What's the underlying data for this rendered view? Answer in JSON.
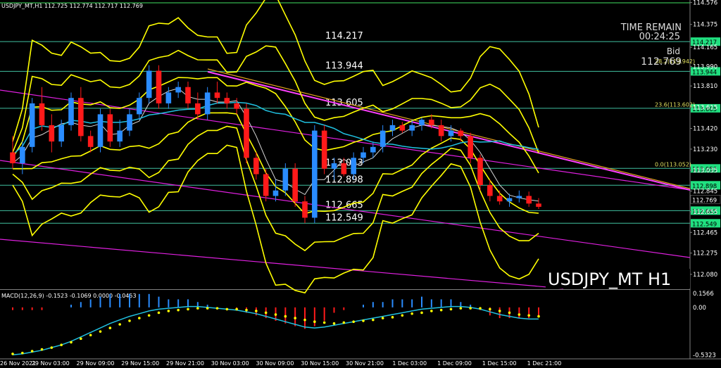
{
  "window": {
    "header": "USDJPY_MT,H1  112.725 112.774 112.717 112.769",
    "time_remain_label": "TIME REMAIN",
    "time_remain": "00:24:25",
    "bid_label": "Bid",
    "bid_value": "112.769",
    "chart_label": "USDJPY_MT H1",
    "macd_label": "MACD(12,26,9) -0.1523 -0.1069 0.0000 -0.0453"
  },
  "colors": {
    "background": "#000000",
    "bull": "#2a8cff",
    "bear": "#ff1a1a",
    "bollinger": "#ffff00",
    "level": "#40c0a0",
    "channel": "#e020e0",
    "trend": "#e0a020",
    "ma_cyan": "#20c0e0",
    "ma_white": "#d8d8d8",
    "macd_hist": "#2a8cff",
    "macd_hist_neg": "#ff1a1a",
    "macd_line": "#20c0e0",
    "macd_signal": "#ffff00",
    "axis_text": "#ffffff",
    "price_tag": "#20e080"
  },
  "chart_data": {
    "type": "candlestick",
    "symbol": "USDJPY_MT",
    "timeframe": "H1",
    "ylim": [
      111.95,
      114.58
    ],
    "y_ticks": [
      "114.576",
      "114.375",
      "114.165",
      "113.990",
      "113.810",
      "113.615",
      "113.420",
      "113.230",
      "113.035",
      "112.845",
      "112.655",
      "112.465",
      "112.275",
      "112.080"
    ],
    "x_ticks": [
      "26 Nov 2021",
      "29 Nov 03:00",
      "29 Nov 09:00",
      "29 Nov 15:00",
      "29 Nov 21:00",
      "30 Nov 03:00",
      "30 Nov 09:00",
      "30 Nov 15:00",
      "30 Nov 21:00",
      "1 Dec 03:00",
      "1 Dec 09:00",
      "1 Dec 15:00",
      "1 Dec 21:00"
    ],
    "levels": [
      {
        "value": 114.217,
        "label": "114.217",
        "tag": "114.217"
      },
      {
        "value": 113.944,
        "label": "113.944",
        "tag": "113.944"
      },
      {
        "value": 113.605,
        "label": "113.605",
        "tag": "113.605"
      },
      {
        "value": 113.053,
        "label": "113.053",
        "tag": "113.053"
      },
      {
        "value": 112.898,
        "label": "112.898",
        "tag": "112.898"
      },
      {
        "value": 112.665,
        "label": "112.665",
        "tag": "112.665"
      },
      {
        "value": 112.549,
        "label": "112.549",
        "tag": "112.549"
      }
    ],
    "fib_labels": [
      {
        "value": 114.0,
        "label": "38.2(113.942)"
      },
      {
        "value": 113.602,
        "label": "23.6(113.602)"
      },
      {
        "value": 113.052,
        "label": "0.0(113.052)"
      }
    ],
    "current_price": {
      "value": 112.769,
      "tag": "112.769"
    },
    "candles": [
      {
        "o": 113.2,
        "h": 113.35,
        "l": 113.05,
        "c": 113.1
      },
      {
        "o": 113.1,
        "h": 113.3,
        "l": 113.0,
        "c": 113.25
      },
      {
        "o": 113.25,
        "h": 113.7,
        "l": 113.2,
        "c": 113.65
      },
      {
        "o": 113.65,
        "h": 113.8,
        "l": 113.4,
        "c": 113.45
      },
      {
        "o": 113.45,
        "h": 113.55,
        "l": 113.2,
        "c": 113.3
      },
      {
        "o": 113.3,
        "h": 113.5,
        "l": 113.25,
        "c": 113.45
      },
      {
        "o": 113.45,
        "h": 113.75,
        "l": 113.4,
        "c": 113.7
      },
      {
        "o": 113.7,
        "h": 113.8,
        "l": 113.3,
        "c": 113.35
      },
      {
        "o": 113.35,
        "h": 113.4,
        "l": 113.2,
        "c": 113.25
      },
      {
        "o": 113.25,
        "h": 113.6,
        "l": 113.2,
        "c": 113.55
      },
      {
        "o": 113.55,
        "h": 113.6,
        "l": 113.25,
        "c": 113.3
      },
      {
        "o": 113.3,
        "h": 113.5,
        "l": 113.25,
        "c": 113.4
      },
      {
        "o": 113.4,
        "h": 113.6,
        "l": 113.35,
        "c": 113.55
      },
      {
        "o": 113.55,
        "h": 113.75,
        "l": 113.5,
        "c": 113.7
      },
      {
        "o": 113.7,
        "h": 114.0,
        "l": 113.65,
        "c": 113.95
      },
      {
        "o": 113.95,
        "h": 114.0,
        "l": 113.6,
        "c": 113.65
      },
      {
        "o": 113.65,
        "h": 113.8,
        "l": 113.6,
        "c": 113.75
      },
      {
        "o": 113.75,
        "h": 113.85,
        "l": 113.7,
        "c": 113.8
      },
      {
        "o": 113.8,
        "h": 113.85,
        "l": 113.6,
        "c": 113.65
      },
      {
        "o": 113.65,
        "h": 113.75,
        "l": 113.5,
        "c": 113.55
      },
      {
        "o": 113.55,
        "h": 113.8,
        "l": 113.5,
        "c": 113.75
      },
      {
        "o": 113.75,
        "h": 113.85,
        "l": 113.65,
        "c": 113.7
      },
      {
        "o": 113.7,
        "h": 113.75,
        "l": 113.6,
        "c": 113.65
      },
      {
        "o": 113.65,
        "h": 113.7,
        "l": 113.55,
        "c": 113.6
      },
      {
        "o": 113.6,
        "h": 113.65,
        "l": 113.1,
        "c": 113.15
      },
      {
        "o": 113.15,
        "h": 113.2,
        "l": 112.95,
        "c": 113.0
      },
      {
        "o": 113.0,
        "h": 113.05,
        "l": 112.75,
        "c": 112.8
      },
      {
        "o": 112.8,
        "h": 112.95,
        "l": 112.75,
        "c": 112.85
      },
      {
        "o": 112.85,
        "h": 113.1,
        "l": 112.8,
        "c": 113.05
      },
      {
        "o": 113.05,
        "h": 113.1,
        "l": 112.7,
        "c": 112.75
      },
      {
        "o": 112.75,
        "h": 112.8,
        "l": 112.55,
        "c": 112.6
      },
      {
        "o": 112.6,
        "h": 113.45,
        "l": 112.55,
        "c": 113.4
      },
      {
        "o": 113.4,
        "h": 113.45,
        "l": 113.0,
        "c": 113.05
      },
      {
        "o": 113.05,
        "h": 113.15,
        "l": 112.95,
        "c": 113.1
      },
      {
        "o": 113.1,
        "h": 113.15,
        "l": 112.98,
        "c": 113.0
      },
      {
        "o": 113.0,
        "h": 113.2,
        "l": 112.95,
        "c": 113.15
      },
      {
        "o": 113.15,
        "h": 113.25,
        "l": 113.1,
        "c": 113.2
      },
      {
        "o": 113.2,
        "h": 113.3,
        "l": 113.15,
        "c": 113.25
      },
      {
        "o": 113.25,
        "h": 113.45,
        "l": 113.2,
        "c": 113.4
      },
      {
        "o": 113.4,
        "h": 113.5,
        "l": 113.35,
        "c": 113.45
      },
      {
        "o": 113.45,
        "h": 113.48,
        "l": 113.38,
        "c": 113.4
      },
      {
        "o": 113.4,
        "h": 113.5,
        "l": 113.35,
        "c": 113.45
      },
      {
        "o": 113.45,
        "h": 113.52,
        "l": 113.4,
        "c": 113.5
      },
      {
        "o": 113.5,
        "h": 113.55,
        "l": 113.42,
        "c": 113.45
      },
      {
        "o": 113.45,
        "h": 113.5,
        "l": 113.3,
        "c": 113.35
      },
      {
        "o": 113.35,
        "h": 113.45,
        "l": 113.3,
        "c": 113.4
      },
      {
        "o": 113.4,
        "h": 113.42,
        "l": 113.3,
        "c": 113.35
      },
      {
        "o": 113.35,
        "h": 113.38,
        "l": 113.1,
        "c": 113.15
      },
      {
        "o": 113.15,
        "h": 113.18,
        "l": 112.85,
        "c": 112.9
      },
      {
        "o": 112.9,
        "h": 112.95,
        "l": 112.75,
        "c": 112.8
      },
      {
        "o": 112.8,
        "h": 112.85,
        "l": 112.72,
        "c": 112.75
      },
      {
        "o": 112.75,
        "h": 112.82,
        "l": 112.7,
        "c": 112.78
      },
      {
        "o": 112.78,
        "h": 112.85,
        "l": 112.74,
        "c": 112.8
      },
      {
        "o": 112.8,
        "h": 112.84,
        "l": 112.7,
        "c": 112.73
      },
      {
        "o": 112.73,
        "h": 112.78,
        "l": 112.68,
        "c": 112.7
      }
    ],
    "macd": {
      "ylim": [
        -0.56,
        0.18
      ],
      "y_ticks": [
        "0.1566",
        "0.00",
        "-0.5323"
      ],
      "line": [
        -0.53,
        -0.52,
        -0.5,
        -0.48,
        -0.45,
        -0.42,
        -0.38,
        -0.33,
        -0.28,
        -0.23,
        -0.18,
        -0.14,
        -0.1,
        -0.07,
        -0.04,
        -0.02,
        -0.01,
        0.0,
        0.01,
        0.01,
        0.0,
        -0.01,
        -0.02,
        -0.03,
        -0.05,
        -0.07,
        -0.1,
        -0.13,
        -0.16,
        -0.19,
        -0.22,
        -0.23,
        -0.22,
        -0.2,
        -0.18,
        -0.16,
        -0.14,
        -0.12,
        -0.1,
        -0.08,
        -0.06,
        -0.04,
        -0.02,
        -0.01,
        0.0,
        0.01,
        0.01,
        0.0,
        -0.02,
        -0.05,
        -0.08,
        -0.1,
        -0.12,
        -0.13,
        -0.13
      ],
      "signal": [
        -0.52,
        -0.51,
        -0.49,
        -0.47,
        -0.45,
        -0.42,
        -0.39,
        -0.35,
        -0.31,
        -0.27,
        -0.23,
        -0.19,
        -0.15,
        -0.12,
        -0.09,
        -0.06,
        -0.04,
        -0.03,
        -0.02,
        -0.01,
        -0.01,
        -0.01,
        -0.02,
        -0.02,
        -0.03,
        -0.04,
        -0.06,
        -0.08,
        -0.1,
        -0.12,
        -0.14,
        -0.16,
        -0.17,
        -0.18,
        -0.17,
        -0.16,
        -0.15,
        -0.14,
        -0.12,
        -0.11,
        -0.09,
        -0.07,
        -0.06,
        -0.04,
        -0.03,
        -0.02,
        -0.01,
        -0.01,
        -0.01,
        -0.02,
        -0.04,
        -0.06,
        -0.08,
        -0.09,
        -0.1
      ],
      "hist": [
        -0.01,
        -0.01,
        -0.01,
        -0.01,
        0.0,
        0.0,
        0.01,
        0.02,
        0.03,
        0.04,
        0.05,
        0.05,
        0.05,
        0.05,
        0.05,
        0.04,
        0.03,
        0.03,
        0.03,
        0.02,
        0.01,
        0.0,
        0.0,
        -0.01,
        -0.02,
        -0.03,
        -0.04,
        -0.05,
        -0.06,
        -0.07,
        -0.08,
        -0.07,
        -0.05,
        -0.02,
        -0.01,
        0.0,
        0.01,
        0.02,
        0.02,
        0.03,
        0.03,
        0.03,
        0.04,
        0.03,
        0.03,
        0.03,
        0.02,
        0.01,
        -0.01,
        -0.03,
        -0.04,
        -0.04,
        -0.04,
        -0.04,
        -0.03
      ]
    }
  }
}
